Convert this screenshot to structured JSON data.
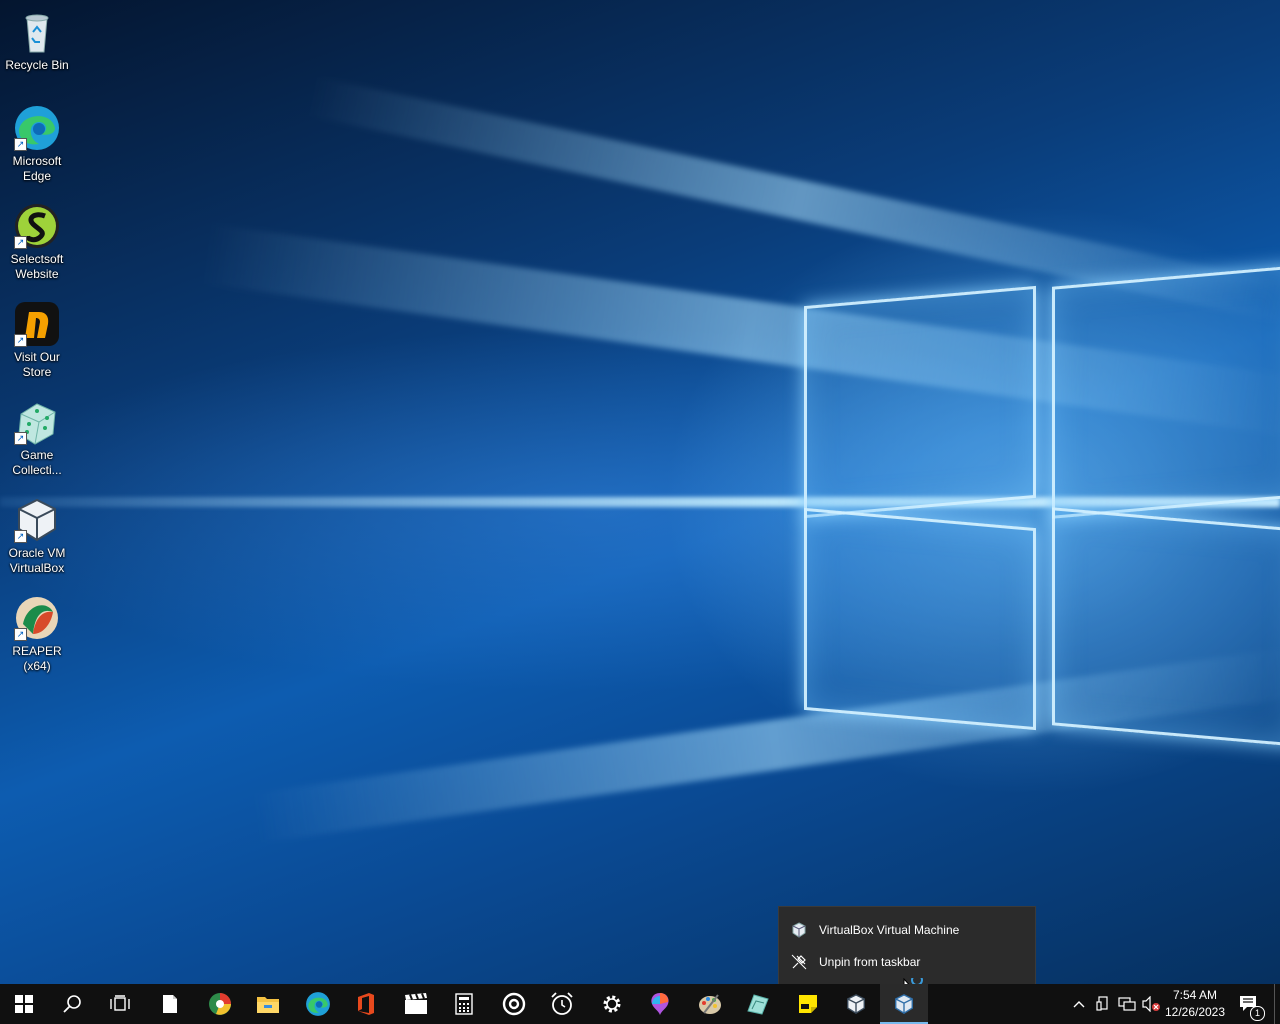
{
  "desktop": {
    "icons": [
      {
        "label": "Recycle Bin",
        "icon": "recycle-bin-icon"
      },
      {
        "label": "Microsoft Edge",
        "icon": "edge-icon"
      },
      {
        "label": "Selectsoft Website",
        "icon": "selectsoft-icon"
      },
      {
        "label": "Visit Our Store",
        "icon": "store-icon"
      },
      {
        "label": "Game Collecti...",
        "icon": "dice-icon"
      },
      {
        "label": "Oracle VM VirtualBox",
        "icon": "virtualbox-icon"
      },
      {
        "label": "REAPER (x64)",
        "icon": "reaper-icon"
      }
    ]
  },
  "context_menu": {
    "items": [
      {
        "label": "VirtualBox Virtual Machine",
        "icon": "virtualbox-icon"
      },
      {
        "label": "Unpin from taskbar",
        "icon": "unpin-icon"
      }
    ]
  },
  "taskbar": {
    "apps": [
      "start-icon",
      "search-icon",
      "task-view-icon",
      "notepad-icon",
      "chrome-like-icon",
      "file-explorer-icon",
      "edge-icon",
      "office-icon",
      "video-editor-icon",
      "calculator-icon",
      "groove-icon",
      "alarms-icon",
      "settings-icon",
      "paint3d-icon",
      "paint-icon",
      "photos-icon",
      "sticky-notes-icon",
      "virtualbox-icon",
      "virtualbox-vm-icon"
    ],
    "tray": [
      "chevron-up-icon",
      "device-icon",
      "network-icon",
      "volume-muted-icon"
    ],
    "clock": {
      "time": "7:54 AM",
      "date": "12/26/2023"
    },
    "notification_count": "1",
    "colors": {
      "background": "#101010",
      "accent": "#76b9ed"
    }
  }
}
